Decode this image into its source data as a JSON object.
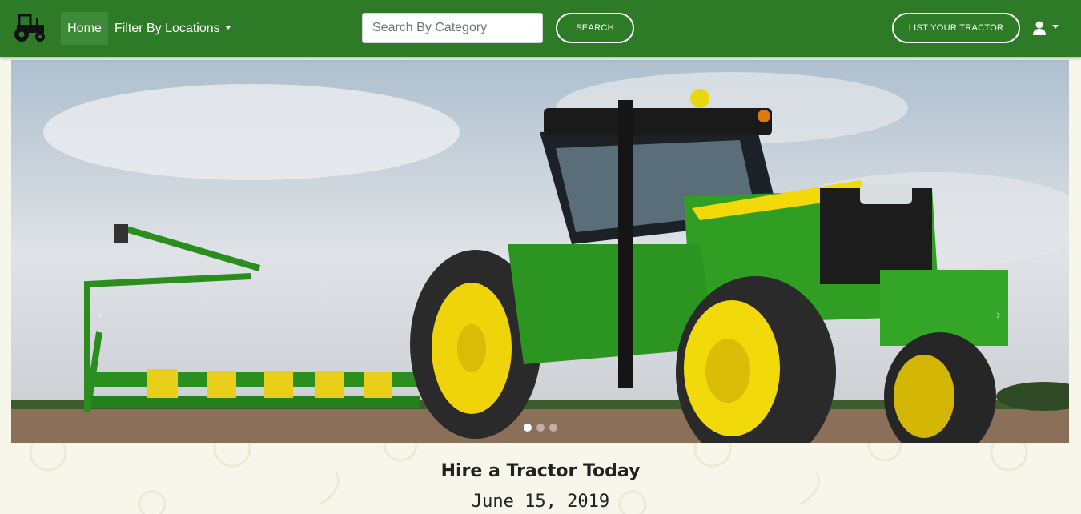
{
  "nav": {
    "brand_icon": "tractor-icon",
    "home": "Home",
    "filter_locations": "Filter By Locations",
    "search_placeholder": "Search By Category",
    "search_button": "SEARCH",
    "list_tractor_button": "LIST YOUR TRACTOR",
    "user_icon": "user-icon"
  },
  "carousel": {
    "slides_count": 3,
    "active_index": 0,
    "prev_icon": "chevron-left-icon",
    "next_icon": "chevron-right-icon"
  },
  "content": {
    "headline": "Hire a Tractor Today",
    "date": "June 15, 2019"
  },
  "colors": {
    "navbar": "#2e7b27",
    "page_background": "#f7f6ea",
    "tractor_green": "#2f9e22",
    "tractor_yellow": "#f2d90a"
  }
}
